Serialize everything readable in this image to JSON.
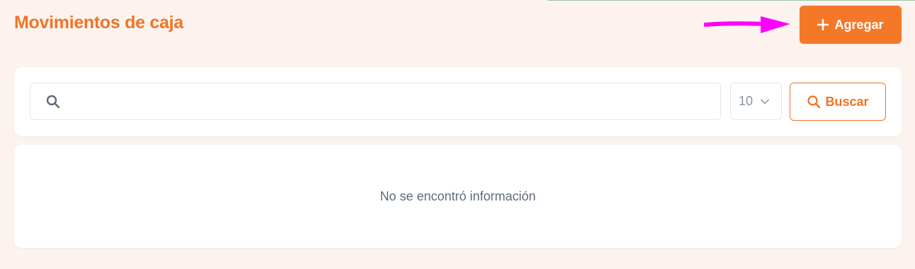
{
  "header": {
    "title": "Movimientos de caja",
    "add_button_label": "Agregar",
    "add_button_icon": "plus-icon"
  },
  "filters": {
    "search_value": "",
    "search_icon": "search-icon",
    "page_size": "10",
    "page_size_icon": "chevron-down-icon",
    "search_button_label": "Buscar",
    "search_button_icon": "search-icon"
  },
  "results": {
    "empty_message": "No se encontró información"
  },
  "colors": {
    "accent": "#f47828",
    "page_background": "#fdf3ee",
    "annotation_arrow": "#ff00ff"
  }
}
